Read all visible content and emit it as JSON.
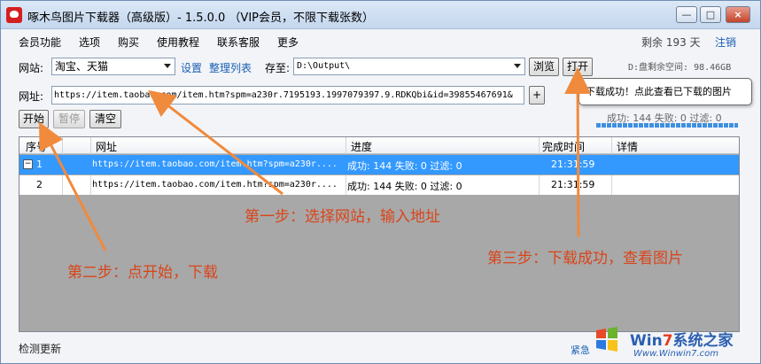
{
  "window": {
    "title": "啄木鸟图片下载器（高级版）- 1.5.0.0 （VIP会员，不限下载张数）",
    "minimize_glyph": "—",
    "maximize_glyph": "□",
    "close_glyph": "×"
  },
  "menu": {
    "items": [
      "会员功能",
      "选项",
      "购买",
      "使用教程",
      "联系客服",
      "更多"
    ],
    "remaining": "剩余 193 天",
    "logout": "注销"
  },
  "site_row": {
    "site_label": "网站:",
    "site_value": "淘宝、天猫",
    "settings_link": "设置",
    "organize_link": "整理列表",
    "save_label": "存至:",
    "save_path": "D:\\Output\\",
    "browse_button": "浏览",
    "open_button": "打开",
    "disk_free": "D:盘剩余空间: 98.46GB"
  },
  "url_row": {
    "url_label": "网址:",
    "url_value": "https://item.taobao.com/item.htm?spm=a230r.7195193.1997079397.9.RDKQbi&id=39855467691&",
    "add_button": "+"
  },
  "actions": {
    "start_button": "开始",
    "pause_button": "暂停",
    "clear_button": "清空"
  },
  "tooltip": "下载成功！点此查看已下载的图片",
  "stats": "成功: 144 失败: 0 过滤: 0",
  "progress_percent": 100,
  "table": {
    "headers": [
      "序号",
      "网址",
      "进度",
      "完成时间",
      "详情"
    ],
    "rows": [
      {
        "index": "1",
        "expander": "−",
        "url": "https://item.taobao.com/item.htm?spm=a230r....",
        "progress": "成功: 144 失败: 0 过滤: 0",
        "time": "21:31:59",
        "detail": ""
      },
      {
        "index": "2",
        "url": "https://item.taobao.com/item.htm?spm=a230r....",
        "progress": "成功: 144 失败: 0 过滤: 0",
        "time": "21:31:59",
        "detail": ""
      }
    ]
  },
  "status_bar": {
    "check_update": "检测更新",
    "partial_left": "紧急"
  },
  "annotations": {
    "step1": "第一步：选择网站，输入地址",
    "step2": "第二步：点开始，下载",
    "step3": "第三步：下载成功，查看图片"
  },
  "watermark": {
    "brand_pre": "Win",
    "brand_seven": "7",
    "brand_post": "系统之家",
    "url": "Www.Winwin7.com"
  },
  "colors": {
    "accent": "#3399ff",
    "annotation": "#f08a3c",
    "annotation_text": "#d9451a",
    "link": "#1a5fb4"
  }
}
